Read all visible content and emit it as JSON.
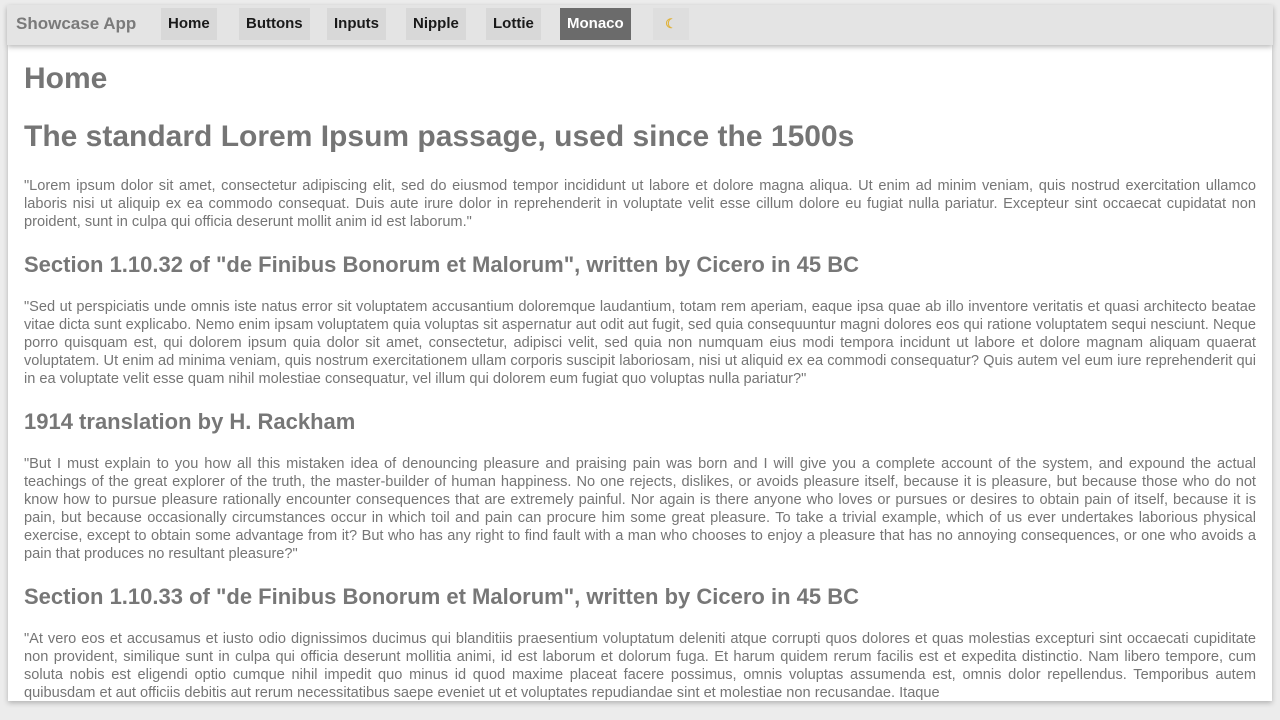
{
  "app": {
    "brand": "Showcase App"
  },
  "nav": {
    "items": [
      {
        "label": "Home"
      },
      {
        "label": "Buttons"
      },
      {
        "label": "Inputs"
      },
      {
        "label": "Nipple"
      },
      {
        "label": "Lottie"
      },
      {
        "label": "Monaco",
        "active": true
      }
    ],
    "theme_toggle_icon": "moon-icon",
    "theme_toggle_glyph": "☾"
  },
  "page": {
    "title": "Home",
    "subtitle": "The standard Lorem Ipsum passage, used since the 1500s",
    "sections": [
      {
        "paragraph": "\"Lorem ipsum dolor sit amet, consectetur adipiscing elit, sed do eiusmod tempor incididunt ut labore et dolore magna aliqua. Ut enim ad minim veniam, quis nostrud exercitation ullamco laboris nisi ut aliquip ex ea commodo consequat. Duis aute irure dolor in reprehenderit in voluptate velit esse cillum dolore eu fugiat nulla pariatur. Excepteur sint occaecat cupidatat non proident, sunt in culpa qui officia deserunt mollit anim id est laborum.\""
      },
      {
        "heading": "Section 1.10.32 of \"de Finibus Bonorum et Malorum\", written by Cicero in 45 BC",
        "paragraph": "\"Sed ut perspiciatis unde omnis iste natus error sit voluptatem accusantium doloremque laudantium, totam rem aperiam, eaque ipsa quae ab illo inventore veritatis et quasi architecto beatae vitae dicta sunt explicabo. Nemo enim ipsam voluptatem quia voluptas sit aspernatur aut odit aut fugit, sed quia consequuntur magni dolores eos qui ratione voluptatem sequi nesciunt. Neque porro quisquam est, qui dolorem ipsum quia dolor sit amet, consectetur, adipisci velit, sed quia non numquam eius modi tempora incidunt ut labore et dolore magnam aliquam quaerat voluptatem. Ut enim ad minima veniam, quis nostrum exercitationem ullam corporis suscipit laboriosam, nisi ut aliquid ex ea commodi consequatur? Quis autem vel eum iure reprehenderit qui in ea voluptate velit esse quam nihil molestiae consequatur, vel illum qui dolorem eum fugiat quo voluptas nulla pariatur?\""
      },
      {
        "heading": "1914 translation by H. Rackham",
        "paragraph": "\"But I must explain to you how all this mistaken idea of denouncing pleasure and praising pain was born and I will give you a complete account of the system, and expound the actual teachings of the great explorer of the truth, the master-builder of human happiness. No one rejects, dislikes, or avoids pleasure itself, because it is pleasure, but because those who do not know how to pursue pleasure rationally encounter consequences that are extremely painful. Nor again is there anyone who loves or pursues or desires to obtain pain of itself, because it is pain, but because occasionally circumstances occur in which toil and pain can procure him some great pleasure. To take a trivial example, which of us ever undertakes laborious physical exercise, except to obtain some advantage from it? But who has any right to find fault with a man who chooses to enjoy a pleasure that has no annoying consequences, or one who avoids a pain that produces no resultant pleasure?\""
      },
      {
        "heading": "Section 1.10.33 of \"de Finibus Bonorum et Malorum\", written by Cicero in 45 BC",
        "paragraph": "\"At vero eos et accusamus et iusto odio dignissimos ducimus qui blanditiis praesentium voluptatum deleniti atque corrupti quos dolores et quas molestias excepturi sint occaecati cupiditate non provident, similique sunt in culpa qui officia deserunt mollitia animi, id est laborum et dolorum fuga. Et harum quidem rerum facilis est et expedita distinctio. Nam libero tempore, cum soluta nobis est eligendi optio cumque nihil impedit quo minus id quod maxime placeat facere possimus, omnis voluptas assumenda est, omnis dolor repellendus. Temporibus autem quibusdam et aut officiis debitis aut rerum necessitatibus saepe eveniet ut et voluptates repudiandae sint et molestiae non recusandae. Itaque"
      }
    ]
  },
  "colors": {
    "navbar_bg": "#e4e4e4",
    "nav_button_bg": "#d8d8d8",
    "nav_active_bg": "#6b6b6b",
    "text": "#777777",
    "page_bg": "#ffffff"
  }
}
